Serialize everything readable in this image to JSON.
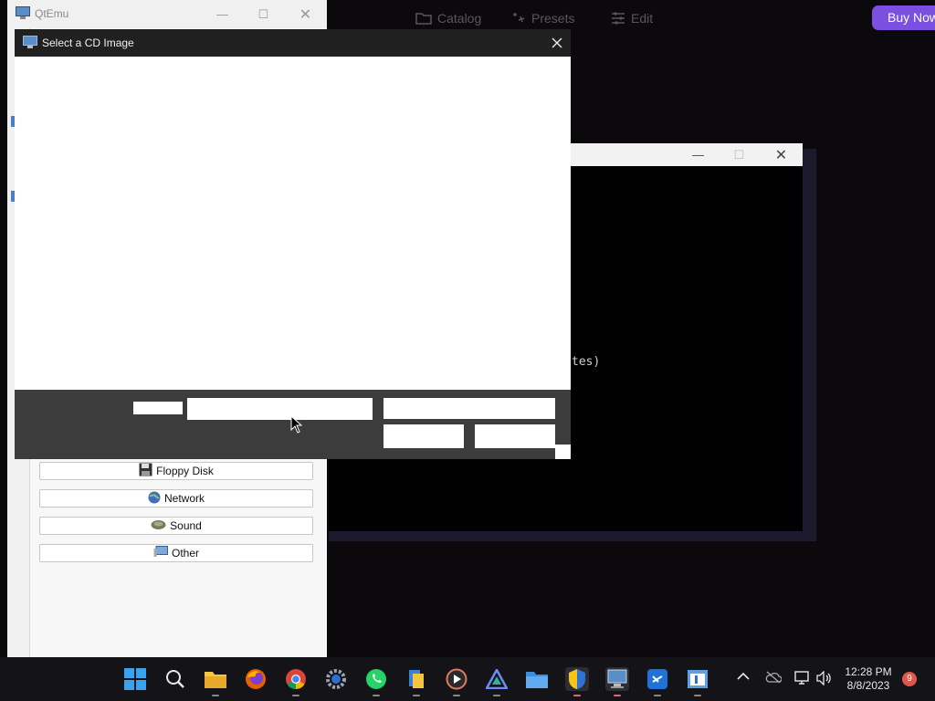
{
  "background_app": {
    "nav": [
      {
        "label": "Catalog",
        "icon": "folder-icon"
      },
      {
        "label": "Presets",
        "icon": "sparkle-icon"
      },
      {
        "label": "Edit",
        "icon": "sliders-icon"
      }
    ],
    "buy_button": "Buy Now"
  },
  "console": {
    "text": "tes)"
  },
  "qtemu": {
    "title": "QtEmu",
    "buttons": [
      {
        "label": "Floppy Disk",
        "icon": "floppy-icon"
      },
      {
        "label": "Network",
        "icon": "globe-icon"
      },
      {
        "label": "Sound",
        "icon": "speaker-icon"
      },
      {
        "label": "Other",
        "icon": "monitor-icon"
      }
    ]
  },
  "dialog": {
    "title": "Select a CD Image"
  },
  "taskbar": {
    "apps": [
      "start",
      "search",
      "file-explorer",
      "firefox",
      "chrome",
      "settings",
      "whatsapp",
      "files",
      "media-player",
      "vpn",
      "folder",
      "security",
      "qtemu",
      "azure-data-studio",
      "sandbox"
    ],
    "time": "12:28 PM",
    "date": "8/8/2023",
    "notification_count": "9"
  },
  "colors": {
    "accent": "#7b4fe0",
    "dialog_title_bg": "#202020",
    "dialog_body_bg": "#ffffff",
    "taskbar_bg": "#141418"
  }
}
